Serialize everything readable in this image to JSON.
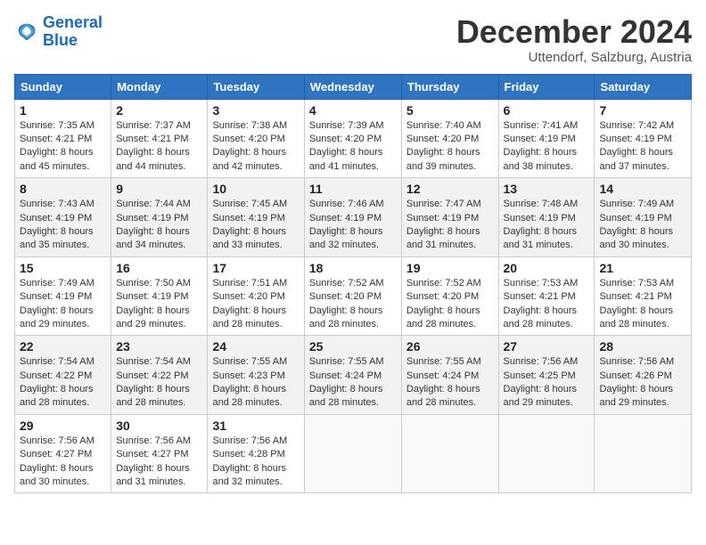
{
  "logo": {
    "line1": "General",
    "line2": "Blue"
  },
  "title": "December 2024",
  "location": "Uttendorf, Salzburg, Austria",
  "weekdays": [
    "Sunday",
    "Monday",
    "Tuesday",
    "Wednesday",
    "Thursday",
    "Friday",
    "Saturday"
  ],
  "weeks": [
    [
      {
        "day": "1",
        "sunrise": "7:35 AM",
        "sunset": "4:21 PM",
        "daylight": "8 hours and 45 minutes."
      },
      {
        "day": "2",
        "sunrise": "7:37 AM",
        "sunset": "4:21 PM",
        "daylight": "8 hours and 44 minutes."
      },
      {
        "day": "3",
        "sunrise": "7:38 AM",
        "sunset": "4:20 PM",
        "daylight": "8 hours and 42 minutes."
      },
      {
        "day": "4",
        "sunrise": "7:39 AM",
        "sunset": "4:20 PM",
        "daylight": "8 hours and 41 minutes."
      },
      {
        "day": "5",
        "sunrise": "7:40 AM",
        "sunset": "4:20 PM",
        "daylight": "8 hours and 39 minutes."
      },
      {
        "day": "6",
        "sunrise": "7:41 AM",
        "sunset": "4:19 PM",
        "daylight": "8 hours and 38 minutes."
      },
      {
        "day": "7",
        "sunrise": "7:42 AM",
        "sunset": "4:19 PM",
        "daylight": "8 hours and 37 minutes."
      }
    ],
    [
      {
        "day": "8",
        "sunrise": "7:43 AM",
        "sunset": "4:19 PM",
        "daylight": "8 hours and 35 minutes."
      },
      {
        "day": "9",
        "sunrise": "7:44 AM",
        "sunset": "4:19 PM",
        "daylight": "8 hours and 34 minutes."
      },
      {
        "day": "10",
        "sunrise": "7:45 AM",
        "sunset": "4:19 PM",
        "daylight": "8 hours and 33 minutes."
      },
      {
        "day": "11",
        "sunrise": "7:46 AM",
        "sunset": "4:19 PM",
        "daylight": "8 hours and 32 minutes."
      },
      {
        "day": "12",
        "sunrise": "7:47 AM",
        "sunset": "4:19 PM",
        "daylight": "8 hours and 31 minutes."
      },
      {
        "day": "13",
        "sunrise": "7:48 AM",
        "sunset": "4:19 PM",
        "daylight": "8 hours and 31 minutes."
      },
      {
        "day": "14",
        "sunrise": "7:49 AM",
        "sunset": "4:19 PM",
        "daylight": "8 hours and 30 minutes."
      }
    ],
    [
      {
        "day": "15",
        "sunrise": "7:49 AM",
        "sunset": "4:19 PM",
        "daylight": "8 hours and 29 minutes."
      },
      {
        "day": "16",
        "sunrise": "7:50 AM",
        "sunset": "4:19 PM",
        "daylight": "8 hours and 29 minutes."
      },
      {
        "day": "17",
        "sunrise": "7:51 AM",
        "sunset": "4:20 PM",
        "daylight": "8 hours and 28 minutes."
      },
      {
        "day": "18",
        "sunrise": "7:52 AM",
        "sunset": "4:20 PM",
        "daylight": "8 hours and 28 minutes."
      },
      {
        "day": "19",
        "sunrise": "7:52 AM",
        "sunset": "4:20 PM",
        "daylight": "8 hours and 28 minutes."
      },
      {
        "day": "20",
        "sunrise": "7:53 AM",
        "sunset": "4:21 PM",
        "daylight": "8 hours and 28 minutes."
      },
      {
        "day": "21",
        "sunrise": "7:53 AM",
        "sunset": "4:21 PM",
        "daylight": "8 hours and 28 minutes."
      }
    ],
    [
      {
        "day": "22",
        "sunrise": "7:54 AM",
        "sunset": "4:22 PM",
        "daylight": "8 hours and 28 minutes."
      },
      {
        "day": "23",
        "sunrise": "7:54 AM",
        "sunset": "4:22 PM",
        "daylight": "8 hours and 28 minutes."
      },
      {
        "day": "24",
        "sunrise": "7:55 AM",
        "sunset": "4:23 PM",
        "daylight": "8 hours and 28 minutes."
      },
      {
        "day": "25",
        "sunrise": "7:55 AM",
        "sunset": "4:24 PM",
        "daylight": "8 hours and 28 minutes."
      },
      {
        "day": "26",
        "sunrise": "7:55 AM",
        "sunset": "4:24 PM",
        "daylight": "8 hours and 28 minutes."
      },
      {
        "day": "27",
        "sunrise": "7:56 AM",
        "sunset": "4:25 PM",
        "daylight": "8 hours and 29 minutes."
      },
      {
        "day": "28",
        "sunrise": "7:56 AM",
        "sunset": "4:26 PM",
        "daylight": "8 hours and 29 minutes."
      }
    ],
    [
      {
        "day": "29",
        "sunrise": "7:56 AM",
        "sunset": "4:27 PM",
        "daylight": "8 hours and 30 minutes."
      },
      {
        "day": "30",
        "sunrise": "7:56 AM",
        "sunset": "4:27 PM",
        "daylight": "8 hours and 31 minutes."
      },
      {
        "day": "31",
        "sunrise": "7:56 AM",
        "sunset": "4:28 PM",
        "daylight": "8 hours and 32 minutes."
      },
      null,
      null,
      null,
      null
    ]
  ],
  "labels": {
    "sunrise": "Sunrise:",
    "sunset": "Sunset:",
    "daylight": "Daylight:"
  }
}
